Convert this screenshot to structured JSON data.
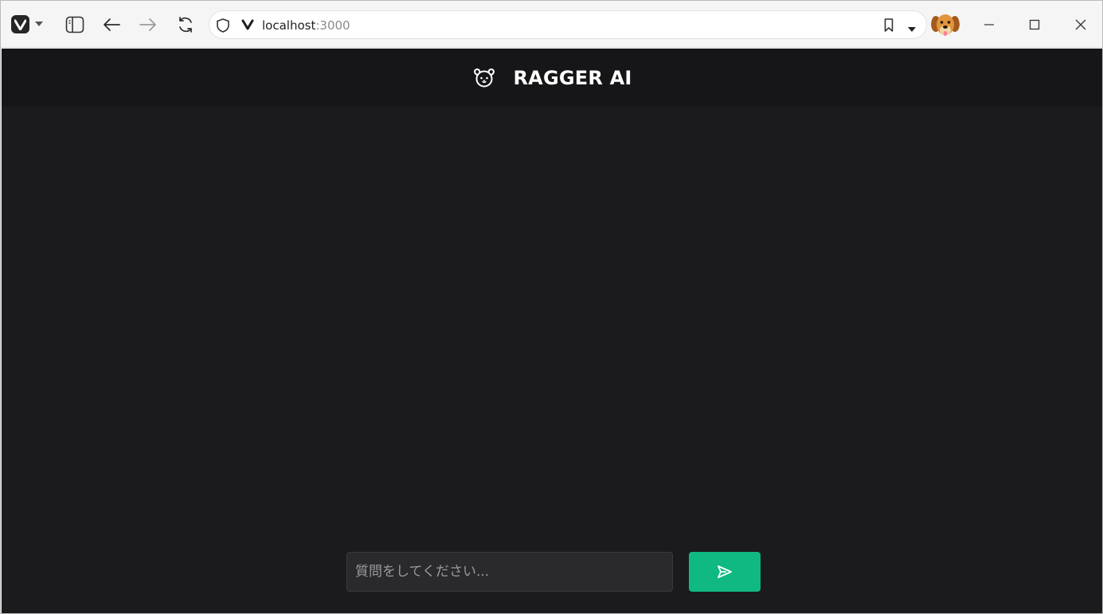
{
  "browser": {
    "url_host": "localhost",
    "url_port": ":3000",
    "icons": {
      "menu": "vivaldi-logo-icon",
      "panel": "sidebar-panel-icon",
      "back": "arrow-left-icon",
      "forward": "arrow-right-icon",
      "reload": "reload-icon",
      "shield": "shield-icon",
      "site": "vivaldi-v-icon",
      "bookmark": "bookmark-icon",
      "dropdown": "chevron-down-icon",
      "minimize": "minimize-icon",
      "maximize": "maximize-icon",
      "close": "close-icon"
    }
  },
  "app": {
    "title": "RAGGER AI",
    "logo_icon": "dog-face-icon",
    "input": {
      "value": "",
      "placeholder": "質問をしてください..."
    },
    "send_icon": "send-icon",
    "colors": {
      "background": "#1b1b1d",
      "header": "#161618",
      "accent": "#10b981"
    }
  }
}
